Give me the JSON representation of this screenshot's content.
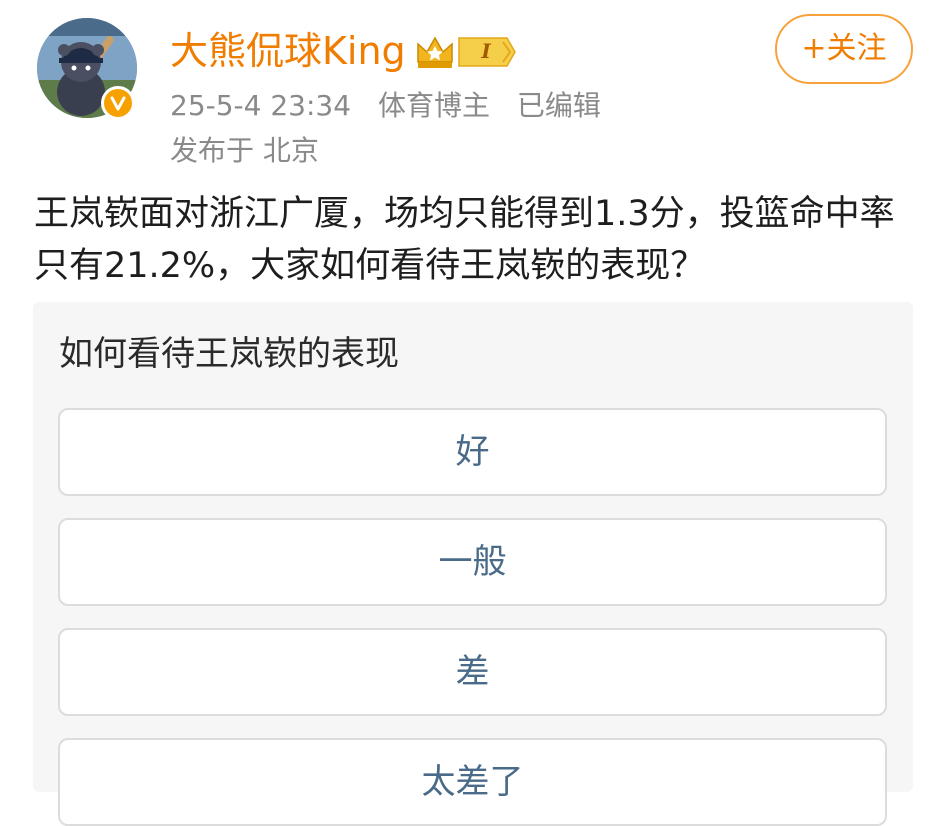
{
  "post": {
    "author": {
      "name": "大熊侃球King",
      "level_badge": "I"
    },
    "meta": {
      "timestamp": "25-5-4 23:34",
      "category": "体育博主",
      "edited": "已编辑",
      "location": "发布于 北京"
    },
    "follow_label": "+关注",
    "text": "王岚嵚面对浙江广厦，场均只能得到1.3分，投篮命中率只有21.2%，大家如何看待王岚嵚的表现？"
  },
  "poll": {
    "title": "如何看待王岚嵚的表现",
    "options": [
      {
        "label": "好"
      },
      {
        "label": "一般"
      },
      {
        "label": "差"
      },
      {
        "label": "太差了"
      }
    ]
  },
  "colors": {
    "accent_orange": "#f07c00",
    "follow_border": "#f7a23a",
    "meta_gray": "#8a8a8a",
    "option_text": "#4a6a8a",
    "poll_bg": "#f6f6f6"
  },
  "icons": {
    "avatar": "baseball-mascot-avatar",
    "verified": "verified-v-icon",
    "crown": "crown-level-icon"
  }
}
